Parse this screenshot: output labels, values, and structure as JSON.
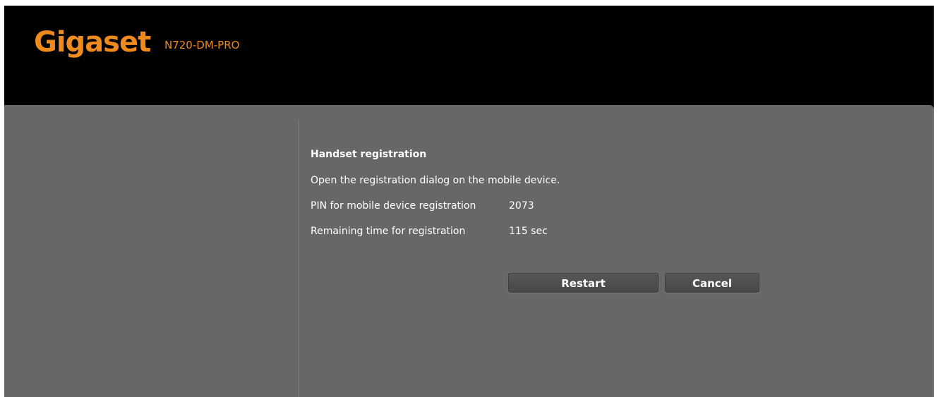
{
  "header": {
    "logo_text": "Gigaset",
    "model": "N720-DM-PRO",
    "brand_color": "#ef8a1d"
  },
  "registration": {
    "title": "Handset registration",
    "instruction": "Open the registration dialog on the mobile device.",
    "pin_label": "PIN for mobile device registration",
    "pin_value": "2073",
    "time_label": "Remaining time for registration",
    "time_value": "115 sec"
  },
  "buttons": {
    "restart_label": "Restart",
    "cancel_label": "Cancel"
  }
}
